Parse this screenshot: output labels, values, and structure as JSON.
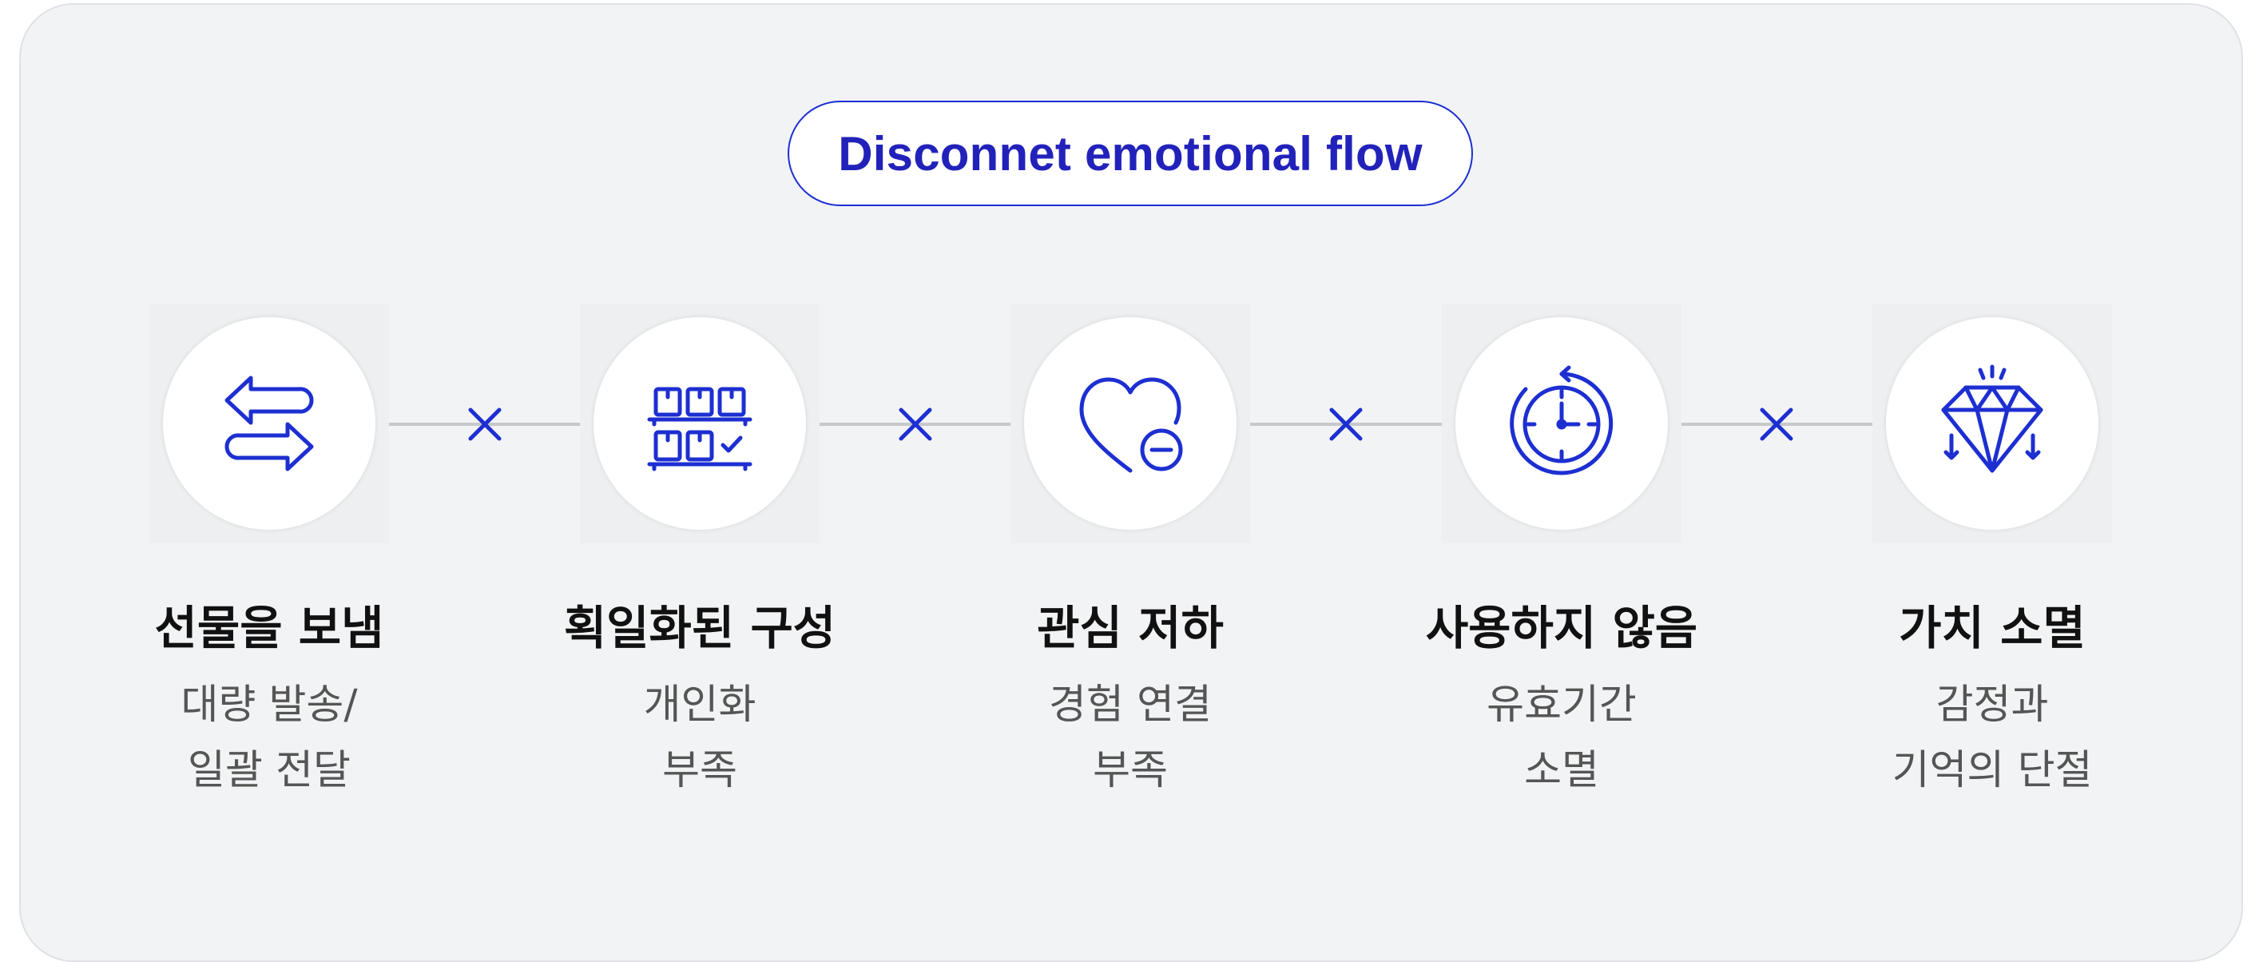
{
  "title": "Disconnet emotional flow",
  "colors": {
    "accent": "#1d2fd1",
    "background": "#f2f3f5",
    "connector": "#c7c8cb"
  },
  "steps": [
    {
      "icon": "swap-arrows-icon",
      "label": "선물을 보냄",
      "desc": [
        "대량 발송/",
        "일괄 전달"
      ]
    },
    {
      "icon": "shelf-boxes-icon",
      "label": "획일화된 구성",
      "desc": [
        "개인화",
        "부족"
      ]
    },
    {
      "icon": "heart-minus-icon",
      "label": "관심 저하",
      "desc": [
        "경험 연결",
        "부족"
      ]
    },
    {
      "icon": "timer-icon",
      "label": "사용하지 않음",
      "desc": [
        "유효기간",
        "소멸"
      ]
    },
    {
      "icon": "diamond-down-icon",
      "label": "가치 소멸",
      "desc": [
        "감정과",
        "기억의 단절"
      ]
    }
  ]
}
